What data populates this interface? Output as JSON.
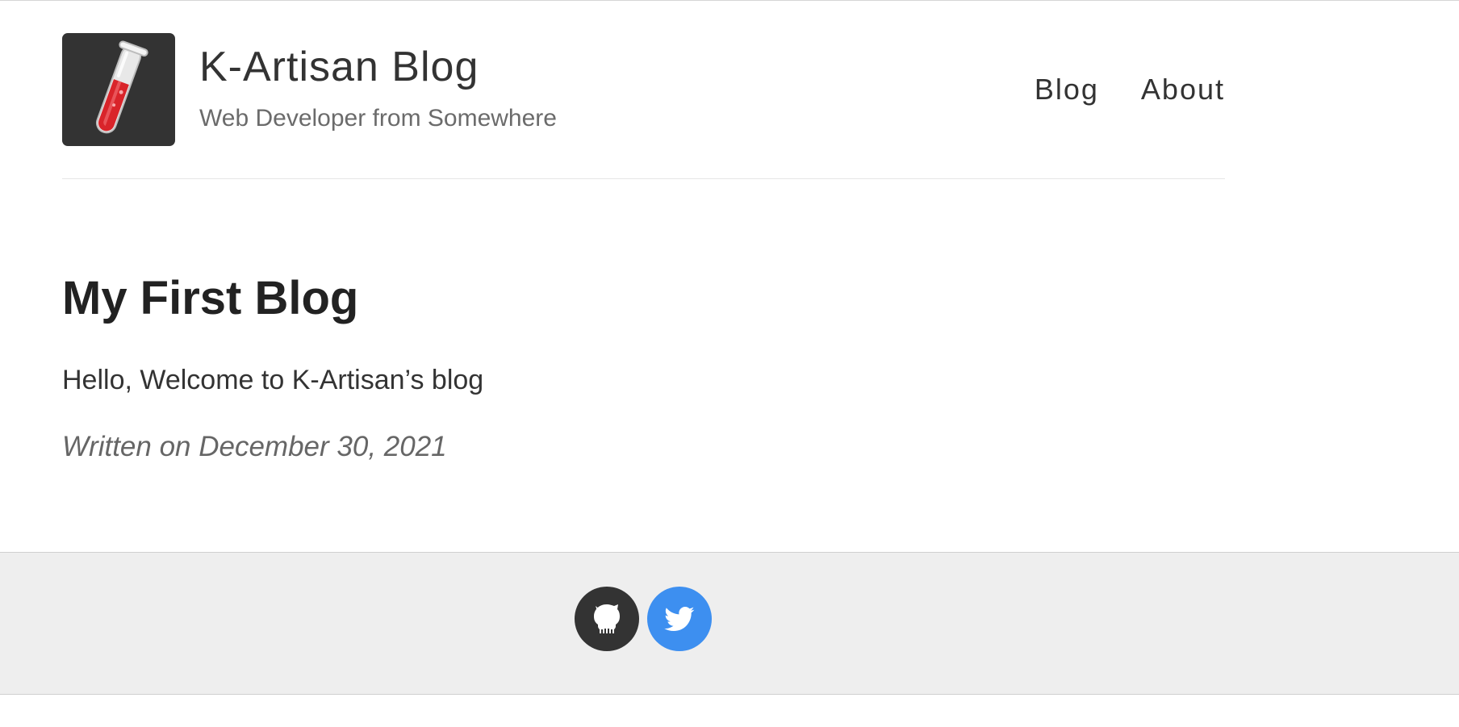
{
  "site": {
    "title": "K-Artisan Blog",
    "description": "Web Developer from Somewhere",
    "logo_icon": "test-tube-icon"
  },
  "nav": {
    "items": [
      {
        "label": "Blog"
      },
      {
        "label": "About"
      }
    ]
  },
  "post": {
    "title": "My First Blog",
    "body": "Hello, Welcome to K-Artisan’s blog",
    "date": "Written on December 30, 2021"
  },
  "footer": {
    "social": [
      {
        "icon": "github-icon",
        "color": "#333333"
      },
      {
        "icon": "twitter-icon",
        "color": "#3d8ff0"
      }
    ]
  },
  "colors": {
    "background": "#ffffff",
    "text": "#333333",
    "footer_background": "#eeeeee"
  }
}
